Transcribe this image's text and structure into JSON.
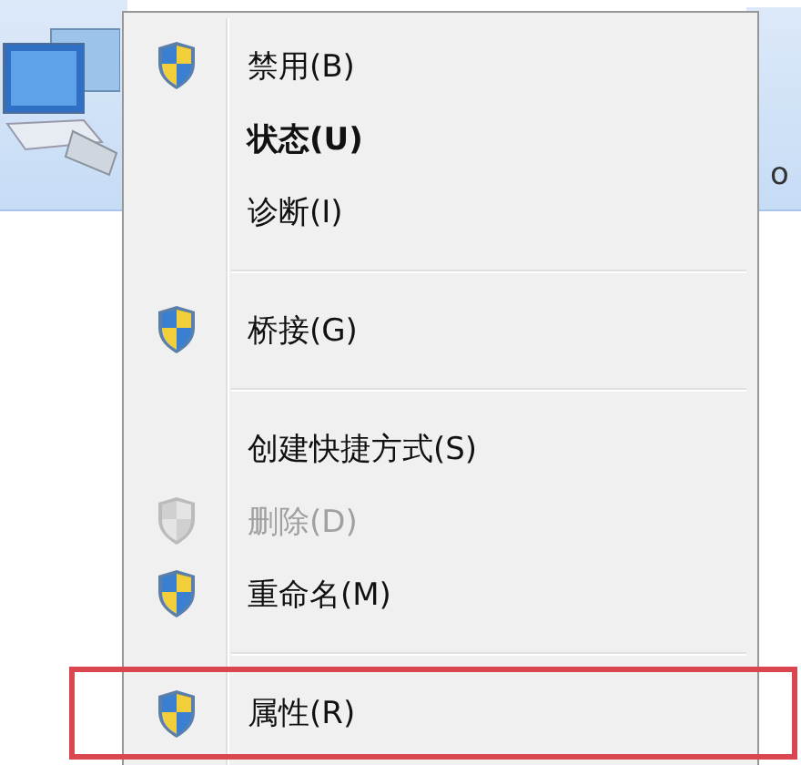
{
  "background": {
    "right_item": {
      "label": "o"
    }
  },
  "menu": {
    "items": [
      {
        "kind": "item",
        "label": "禁用(B)",
        "shield": true,
        "bold": false,
        "disabled": false,
        "outlined": false
      },
      {
        "kind": "item",
        "label": "状态(U)",
        "shield": false,
        "bold": true,
        "disabled": false,
        "outlined": false
      },
      {
        "kind": "item",
        "label": "诊断(I)",
        "shield": false,
        "bold": false,
        "disabled": false,
        "outlined": false
      },
      {
        "kind": "separator"
      },
      {
        "kind": "item",
        "label": "桥接(G)",
        "shield": true,
        "bold": false,
        "disabled": false,
        "outlined": false
      },
      {
        "kind": "separator"
      },
      {
        "kind": "item",
        "label": "创建快捷方式(S)",
        "shield": false,
        "bold": false,
        "disabled": false,
        "outlined": false
      },
      {
        "kind": "item",
        "label": "删除(D)",
        "shield": true,
        "bold": false,
        "disabled": true,
        "outlined": false
      },
      {
        "kind": "item",
        "label": "重命名(M)",
        "shield": true,
        "bold": false,
        "disabled": false,
        "outlined": false
      },
      {
        "kind": "separator"
      },
      {
        "kind": "item",
        "label": "属性(R)",
        "shield": true,
        "bold": false,
        "disabled": false,
        "outlined": true
      }
    ]
  }
}
